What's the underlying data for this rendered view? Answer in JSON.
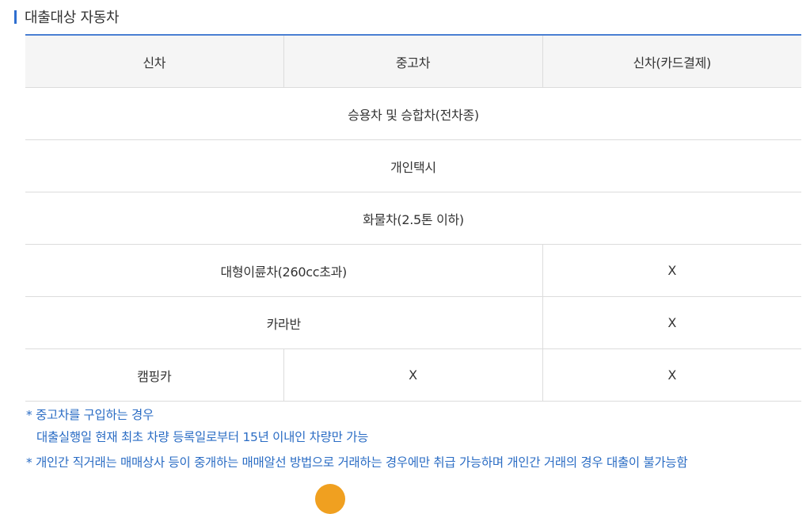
{
  "section": {
    "title": "대출대상 자동차"
  },
  "table": {
    "headers": [
      "신차",
      "중고차",
      "신차(카드결제)"
    ],
    "rows": {
      "passenger": "승용차 및 승합차(전차종)",
      "taxi": "개인택시",
      "truck": "화물차(2.5톤 이하)",
      "motorcycle": {
        "label": "대형이륜차(260cc초과)",
        "card": "X"
      },
      "caravan": {
        "label": "카라반",
        "card": "X"
      },
      "camping": {
        "label": "캠핑카",
        "used": "X",
        "card": "X"
      }
    }
  },
  "notes": {
    "used_car_line1": "* 중고차를 구입하는 경우",
    "used_car_line2": "대출실행일 현재 최초 차량 등록일로부터 15년 이내인 차량만 가능",
    "private_trade": "* 개인간 직거래는 매매상사 등이 중개하는 매매알선 방법으로 거래하는 경우에만 취급 가능하며 개인간 거래의 경우 대출이 불가능함"
  },
  "colors": {
    "accent": "#2f6fd0",
    "note_text": "#2a6cc4",
    "header_bg": "#f5f5f5",
    "border": "#dcdcdc"
  }
}
